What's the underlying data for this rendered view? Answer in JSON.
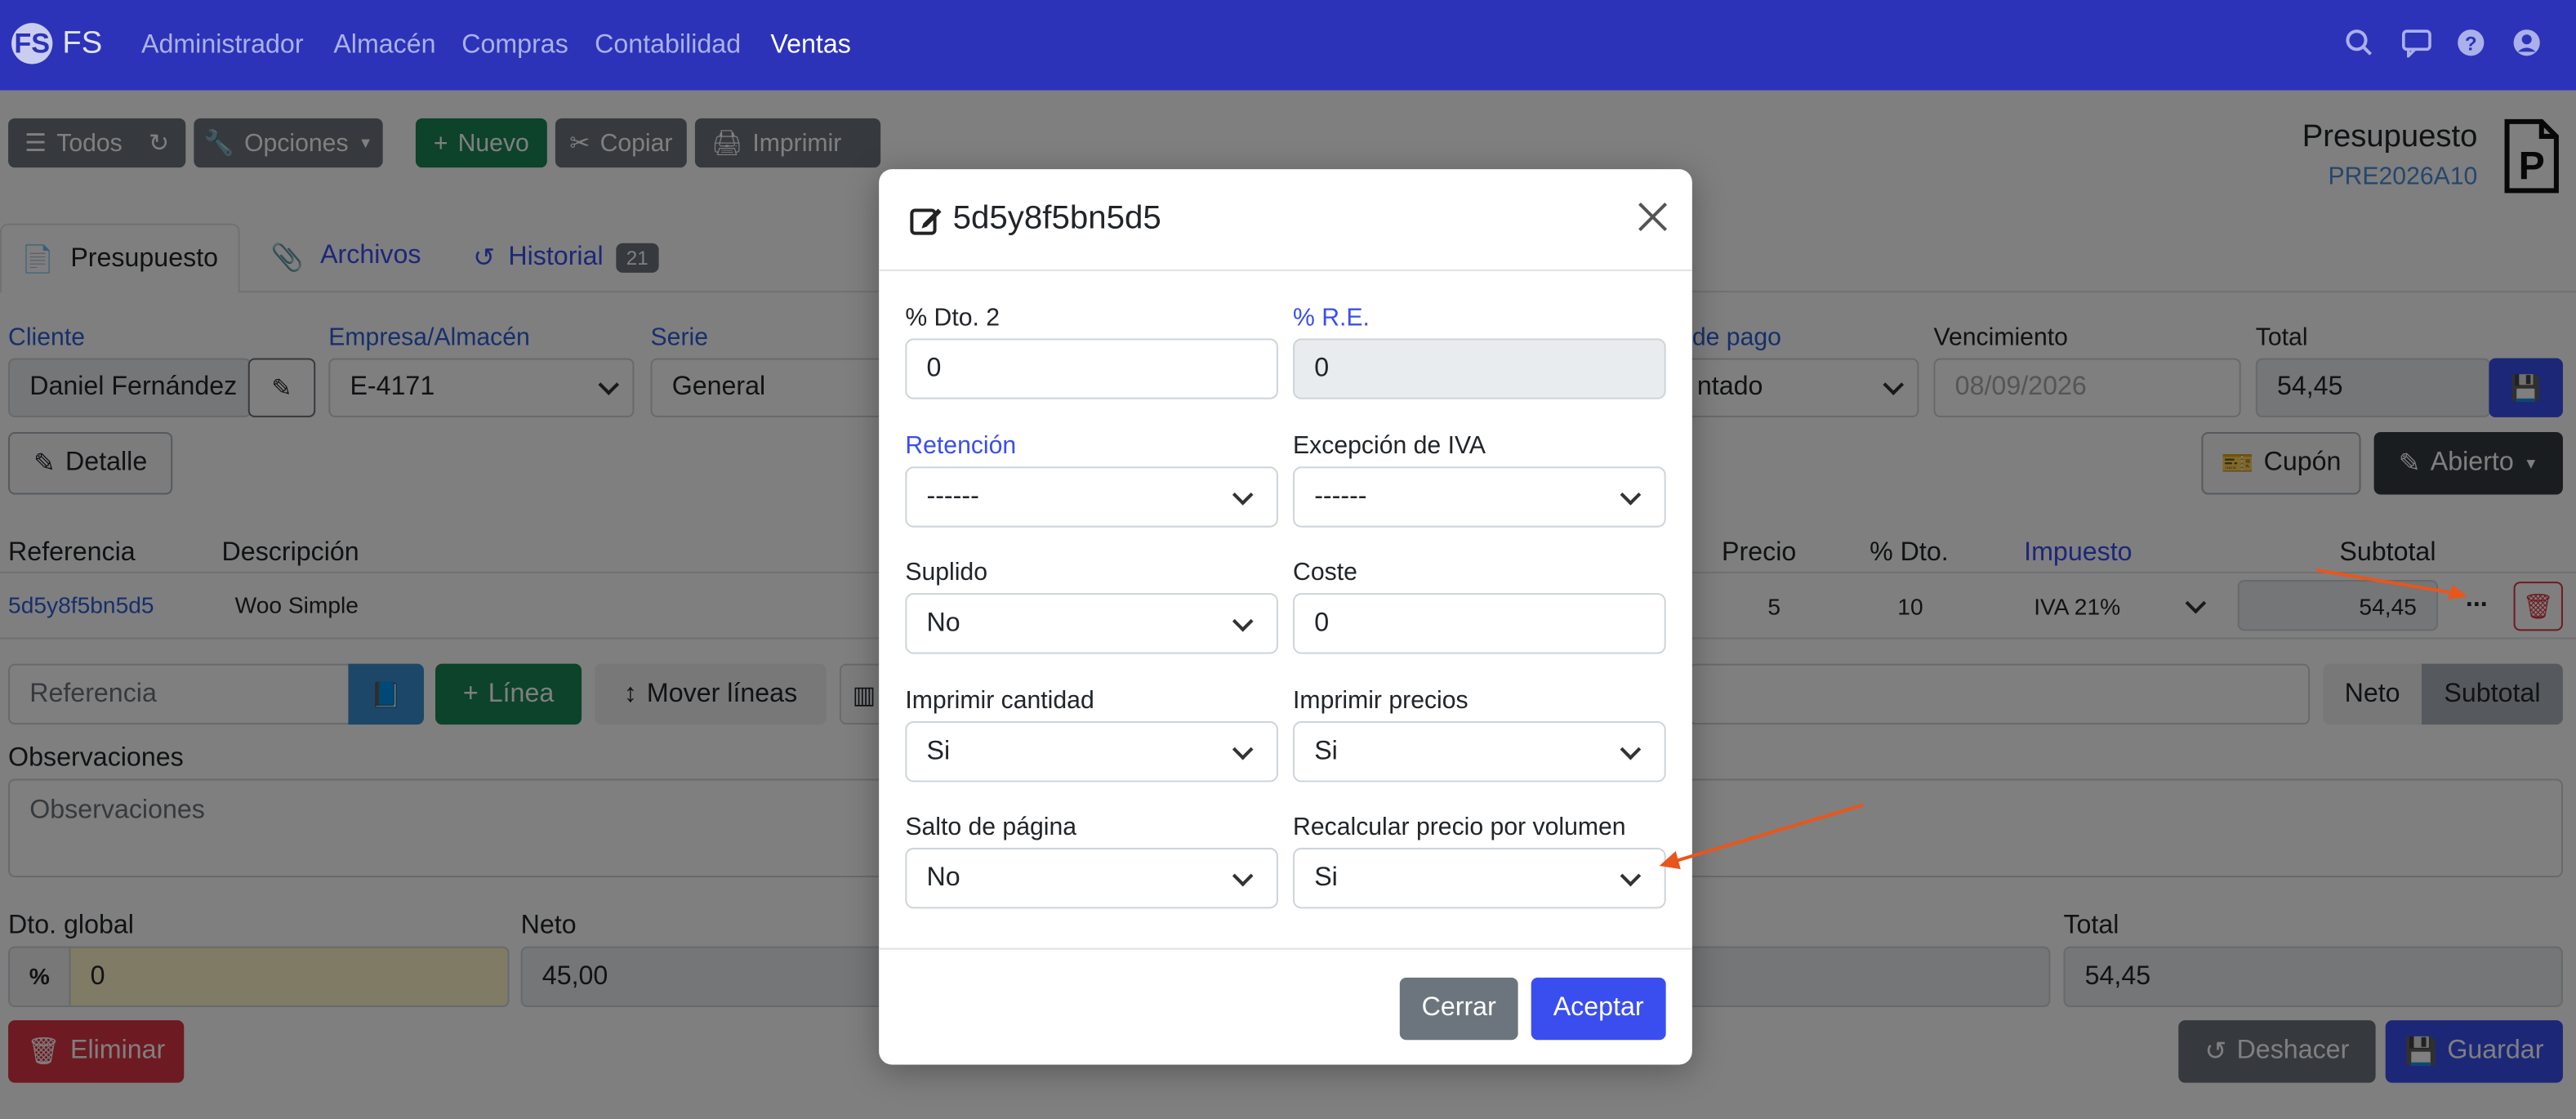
{
  "navbar": {
    "logo": "FS",
    "brand": "FS",
    "menu": [
      "Administrador",
      "Almacén",
      "Compras",
      "Contabilidad",
      "Ventas"
    ],
    "active": "Ventas"
  },
  "toolbar": {
    "todos": "Todos",
    "opciones": "Opciones",
    "nuevo": "Nuevo",
    "copiar": "Copiar",
    "imprimir": "Imprimir"
  },
  "doc": {
    "type": "Presupuesto",
    "code": "PRE2026A10",
    "icon_letter": "P"
  },
  "tabs": [
    {
      "label": "Presupuesto"
    },
    {
      "label": "Archivos"
    },
    {
      "label": "Historial",
      "badge": "21"
    }
  ],
  "header_form": {
    "cliente_label": "Cliente",
    "cliente_value": "Daniel Fernández",
    "empresa_label": "Empresa/Almacén",
    "empresa_value": "E-4171",
    "serie_label": "Serie",
    "serie_value": "General",
    "pago_label": "de pago",
    "pago_value": "ntado",
    "venc_label": "Vencimiento",
    "venc_value": "08/09/2026",
    "total_label": "Total",
    "total_value": "54,45"
  },
  "actions": {
    "detalle": "Detalle",
    "cupon": "Cupón",
    "abierto": "Abierto"
  },
  "lines": {
    "headers": {
      "referencia": "Referencia",
      "descripcion": "Descripción",
      "precio": "Precio",
      "dto": "% Dto.",
      "impuesto": "Impuesto",
      "subtotal": "Subtotal"
    },
    "row": {
      "referencia": "5d5y8f5bn5d5",
      "descripcion": "Woo Simple",
      "precio": "5",
      "dto": "10",
      "impuesto": "IVA 21%",
      "subtotal": "54,45",
      "more": "..."
    }
  },
  "addline": {
    "placeholder": "Referencia",
    "linea": "Línea",
    "mover": "Mover líneas",
    "neto": "Neto",
    "subtotal": "Subtotal"
  },
  "observaciones": {
    "label": "Observaciones",
    "placeholder": "Observaciones"
  },
  "totals": {
    "dto_label": "Dto. global",
    "dto_symbol": "%",
    "dto_value": "0",
    "neto_label": "Neto",
    "neto_value": "45,00",
    "total_label": "Total",
    "total_value": "54,45"
  },
  "bottom": {
    "eliminar": "Eliminar",
    "deshacer": "Deshacer",
    "guardar": "Guardar"
  },
  "modal": {
    "title": "5d5y8f5bn5d5",
    "fields": {
      "dto2_label": "% Dto. 2",
      "dto2_value": "0",
      "re_label": "% R.E.",
      "re_value": "0",
      "retencion_label": "Retención",
      "retencion_value": "------",
      "excepcion_label": "Excepción de IVA",
      "excepcion_value": "------",
      "suplido_label": "Suplido",
      "suplido_value": "No",
      "coste_label": "Coste",
      "coste_value": "0",
      "impcant_label": "Imprimir cantidad",
      "impcant_value": "Si",
      "impprec_label": "Imprimir precios",
      "impprec_value": "Si",
      "salto_label": "Salto de página",
      "salto_value": "No",
      "recalc_label": "Recalcular precio por volumen",
      "recalc_value": "Si"
    },
    "cerrar": "Cerrar",
    "aceptar": "Aceptar"
  },
  "colors": {
    "navbar": "#2c33b8",
    "primary": "#3a4ef0",
    "success": "#198754",
    "danger": "#dc3545",
    "arrow": "#e8561c"
  }
}
